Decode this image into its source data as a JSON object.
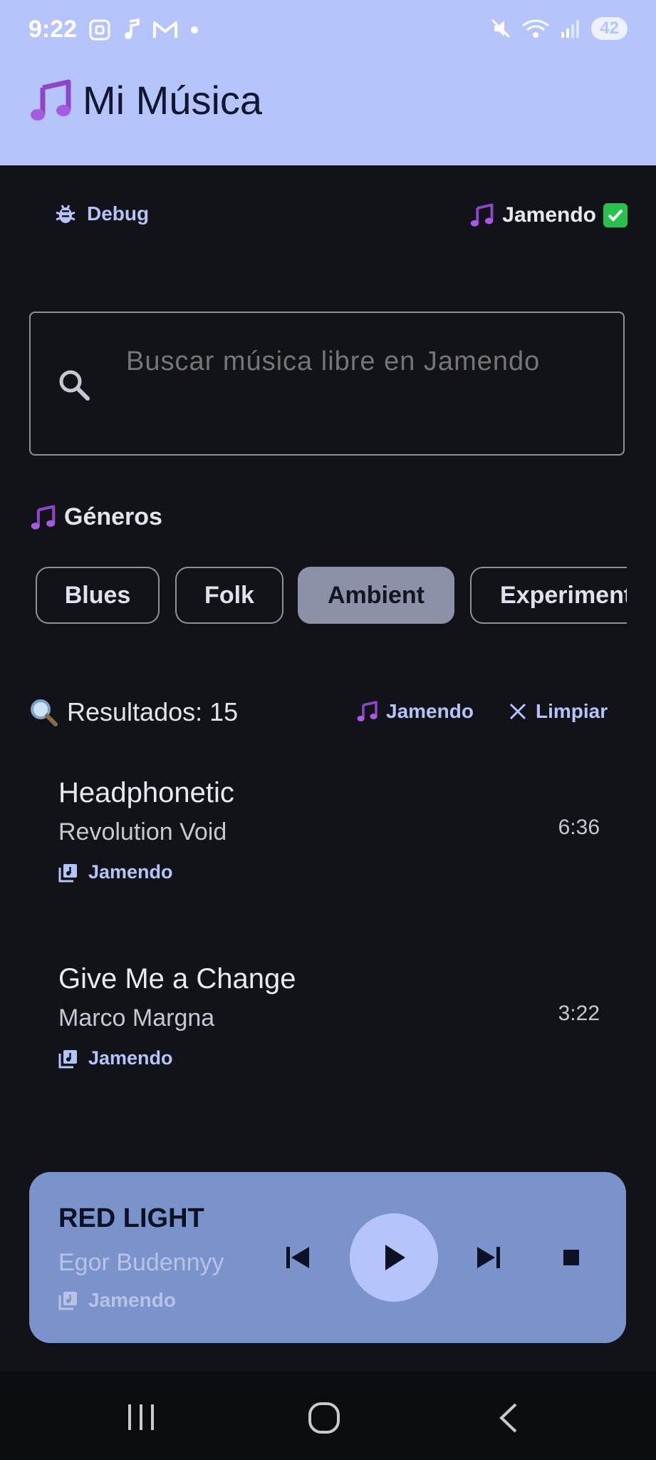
{
  "status_bar": {
    "time": "9:22",
    "battery": "42"
  },
  "app_bar": {
    "title": "Mi Música",
    "title_icon": "music-note-icon"
  },
  "toolbar": {
    "debug_label": "Debug",
    "source_label": "Jamendo",
    "source_ok": true
  },
  "search": {
    "placeholder": "Buscar música libre en Jamendo",
    "value": ""
  },
  "genres": {
    "title": "Géneros",
    "items": [
      {
        "label": "Blues",
        "selected": false
      },
      {
        "label": "Folk",
        "selected": false
      },
      {
        "label": "Ambient",
        "selected": true
      },
      {
        "label": "Experimental",
        "selected": false
      }
    ]
  },
  "results": {
    "label": "Resultados: 15",
    "source_label": "Jamendo",
    "clear_label": "Limpiar"
  },
  "tracks": [
    {
      "title": "Headphonetic",
      "artist": "Revolution Void",
      "source": "Jamendo",
      "duration": "6:36"
    },
    {
      "title": "Give Me a Change",
      "artist": "Marco Margna",
      "source": "Jamendo",
      "duration": "3:22"
    }
  ],
  "player": {
    "title": "RED LIGHT",
    "artist": "Egor Budennyy",
    "source": "Jamendo"
  },
  "colors": {
    "app_bar": "#b5c4fb",
    "background": "#121318",
    "accent": "#b4c3f8",
    "player": "#7a94cb",
    "chip_selected": "#8c91a8"
  }
}
